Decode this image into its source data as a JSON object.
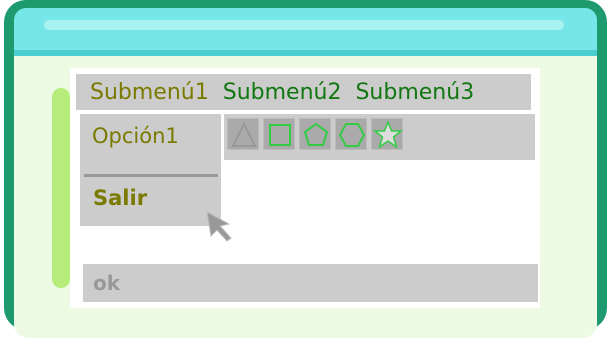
{
  "menubar": {
    "items": [
      {
        "label": "Submenú1"
      },
      {
        "label": "Submenú2"
      },
      {
        "label": "Submenú3"
      }
    ]
  },
  "dropdown": {
    "items": [
      {
        "label": "Opción1"
      },
      {
        "label": "Salir"
      }
    ]
  },
  "toolbar": {
    "tools": [
      {
        "icon": "triangle-icon"
      },
      {
        "icon": "square-icon"
      },
      {
        "icon": "pentagon-icon"
      },
      {
        "icon": "hexagon-icon"
      },
      {
        "icon": "star-icon"
      }
    ]
  },
  "okbar": {
    "label": "ok"
  },
  "colors": {
    "frame": "#1d9a6e",
    "titlebar": "#76e6e8",
    "menu_active": "#7a7a00",
    "menu_inactive": "#117711",
    "widget_bg": "#cccccc",
    "shape_stroke": "#33cc44"
  }
}
